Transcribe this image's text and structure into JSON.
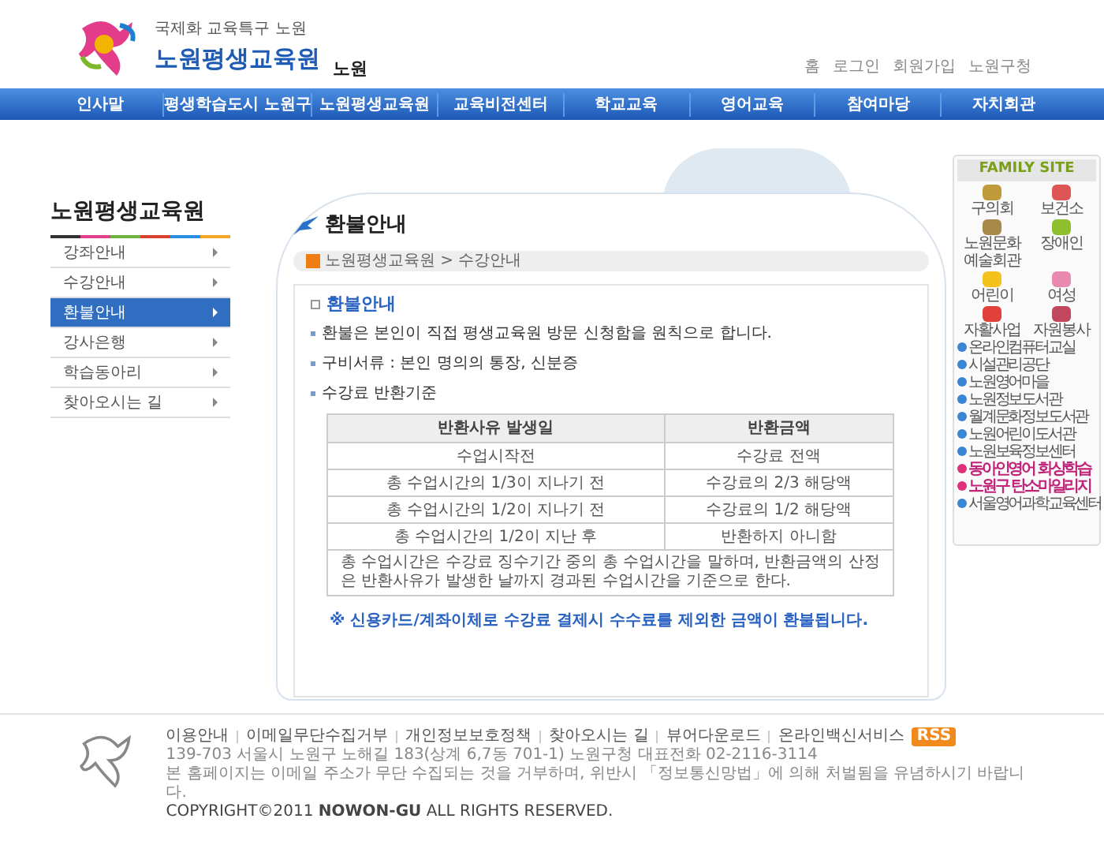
{
  "header": {
    "slogan": "국제화 교육특구 노원",
    "site_title": "노원평생교육원",
    "logo_text": "노원",
    "util_links": [
      "홈",
      "로그인",
      "회원가입",
      "노원구청"
    ]
  },
  "nav": [
    "인사말",
    "평생학습도시 노원구",
    "노원평생교육원",
    "교육비전센터",
    "학교교육",
    "영어교육",
    "참여마당",
    "자치회관"
  ],
  "sidebar": {
    "title": "노원평생교육원",
    "items": [
      {
        "label": "강좌안내",
        "selected": false
      },
      {
        "label": "수강안내",
        "selected": false
      },
      {
        "label": "환불안내",
        "selected": true
      },
      {
        "label": "강사은행",
        "selected": false
      },
      {
        "label": "학습동아리",
        "selected": false
      },
      {
        "label": "찾아오시는 길",
        "selected": false
      }
    ]
  },
  "page": {
    "title": "환불안내",
    "breadcrumb": "노원평생교육원 > 수강안내",
    "section_title": "환불안내",
    "bullets": [
      "환불은 본인이 직접 평생교육원 방문 신청함을 원칙으로 합니다.",
      "구비서류 : 본인 명의의 통장, 신분증",
      "수강료 반환기준"
    ],
    "table": {
      "columns": [
        "반환사유 발생일",
        "반환금액"
      ],
      "rows": [
        [
          "수업시작전",
          "수강료 전액"
        ],
        [
          "총 수업시간의 1/3이 지나기 전",
          "수강료의 2/3 해당액"
        ],
        [
          "총 수업시간의 1/2이 지나기 전",
          "수강료의 1/2 해당액"
        ],
        [
          "총 수업시간의 1/2이 지난 후",
          "반환하지 아니함"
        ]
      ],
      "note": "총 수업시간은 수강료 징수기간 중의 총 수업시간을 말하며, 반환금액의 산정은 반환사유가 발생한 날까지 경과된 수업시간을 기준으로 한다."
    },
    "notice": "※ 신용카드/계좌이체로 수강료 결제시 수수료를 제외한 금액이 환불됩니다."
  },
  "family_site": {
    "title": "FAMILY SITE",
    "items": [
      {
        "kind": "tile",
        "label": "구의회"
      },
      {
        "kind": "tile",
        "label": "보건소"
      },
      {
        "kind": "tile",
        "label": "노원문화예술회관"
      },
      {
        "kind": "tile",
        "label": "장애인"
      },
      {
        "kind": "tile",
        "label": "어린이"
      },
      {
        "kind": "tile",
        "label": "여성"
      },
      {
        "kind": "tile",
        "label": "자활사업"
      },
      {
        "kind": "tile",
        "label": "자원봉사"
      },
      {
        "kind": "link",
        "label": "온라인컴퓨터교실"
      },
      {
        "kind": "link",
        "label": "시설관리공단"
      },
      {
        "kind": "link",
        "label": "노원영어마을"
      },
      {
        "kind": "link",
        "label": "노원정보도서관"
      },
      {
        "kind": "link",
        "label": "월계문화정보도서관"
      },
      {
        "kind": "link",
        "label": "노원어린이도서관"
      },
      {
        "kind": "link",
        "label": "노원보육정보센터"
      },
      {
        "kind": "promo",
        "label": "동아인영어 화상학습"
      },
      {
        "kind": "promo",
        "label": "노원구 탄소마일리지"
      },
      {
        "kind": "link",
        "label": "서울영어과학교육센터"
      }
    ]
  },
  "footer": {
    "links": [
      "이용안내",
      "이메일무단수집거부",
      "개인정보보호정책",
      "찾아오시는 길",
      "뷰어다운로드",
      "온라인백신서비스"
    ],
    "rss": "RSS",
    "address": "139-703 서울시 노원구 노해길 183(상계 6,7동 701-1) 노원구청 대표전화 02-2116-3114",
    "warning": "본 홈페이지는 이메일 주소가 무단 수집되는 것을 거부하며, 위반시 「정보통신망법」에 의해 처벌됨을 유념하시기 바랍니다.",
    "copyright": "COPYRIGHT©2011 **NOWON-GU** ALL RIGHTS RESERVED."
  }
}
